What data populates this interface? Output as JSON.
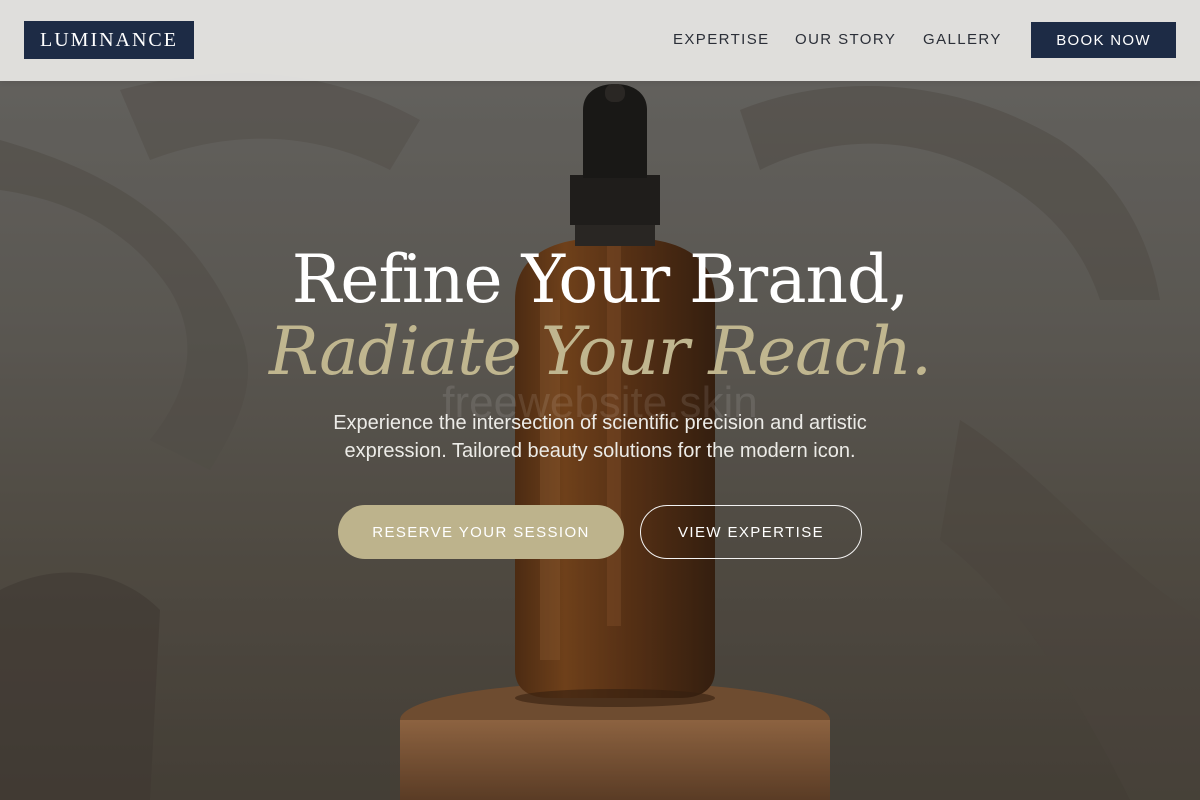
{
  "header": {
    "logo": "LUMINANCE",
    "nav": [
      "EXPERTISE",
      "OUR STORY",
      "GALLERY"
    ],
    "cta": "BOOK NOW"
  },
  "hero": {
    "title_line1": "Refine Your Brand,",
    "title_line2": "Radiate Your Reach.",
    "watermark": "freewebsite.skin",
    "subtitle_line1": "Experience the intersection of scientific precision and artistic",
    "subtitle_line2": "expression. Tailored beauty solutions for the modern icon.",
    "primary_button": "RESERVE YOUR SESSION",
    "secondary_button": "VIEW EXPERTISE"
  },
  "colors": {
    "navy": "#1d2b45",
    "gold": "#bdb38c",
    "gold_text": "#c0b68f",
    "amber_bottle": "#7a3f12"
  }
}
